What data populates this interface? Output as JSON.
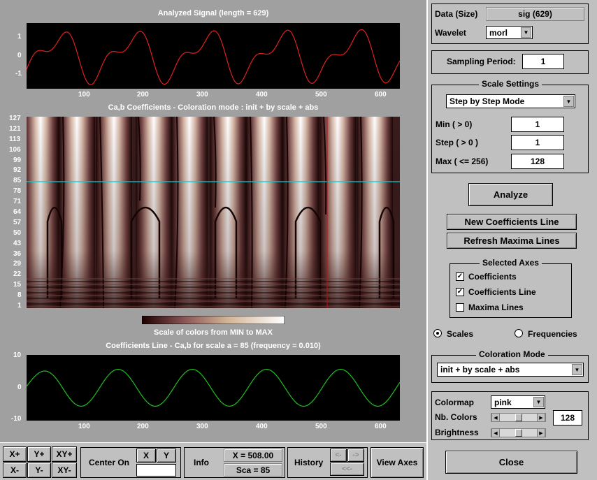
{
  "plots": {
    "signal": {
      "title": "Analyzed Signal  (length = 629)",
      "y_ticks": [
        "1",
        "0",
        "-1"
      ],
      "x_ticks": [
        "100",
        "200",
        "300",
        "400",
        "500",
        "600"
      ]
    },
    "coefs": {
      "title": "Ca,b Coefficients  - Coloration mode : init + by scale + abs",
      "y_ticks": [
        "127",
        "121",
        "113",
        "106",
        "99",
        "92",
        "85",
        "78",
        "71",
        "64",
        "57",
        "50",
        "43",
        "36",
        "29",
        "22",
        "15",
        "8",
        "1"
      ]
    },
    "colorbar_label": "Scale of colors from MIN to MAX",
    "line": {
      "title": "Coefficients Line - Ca,b  for scale a = 85  (frequency =   0.010)",
      "y_ticks": [
        "10",
        "0",
        "-10"
      ],
      "x_ticks": [
        "100",
        "200",
        "300",
        "400",
        "500",
        "600"
      ]
    }
  },
  "right": {
    "data_label": "Data  (Size)",
    "data_value": "sig  (629)",
    "wavelet_label": "Wavelet",
    "wavelet_value": "morl",
    "sampling_label": "Sampling Period:",
    "sampling_value": "1",
    "scale_settings_title": "Scale Settings",
    "scale_mode": "Step by Step Mode",
    "min_label": "Min  ( > 0)",
    "min_value": "1",
    "step_label": "Step ( > 0 )",
    "step_value": "1",
    "max_label": "Max  ( <= 256)",
    "max_value": "128",
    "analyze": "Analyze",
    "new_coef": "New Coefficients Line",
    "refresh": "Refresh Maxima Lines",
    "selected_axes_title": "Selected Axes",
    "axes": [
      {
        "label": "Coefficients",
        "checked": true
      },
      {
        "label": "Coefficients Line",
        "checked": true
      },
      {
        "label": "Maxima Lines",
        "checked": false
      }
    ],
    "scales": "Scales",
    "frequencies": "Frequencies",
    "coloration_title": "Coloration Mode",
    "coloration_value": "init + by scale + abs",
    "colormap_label": "Colormap",
    "colormap_value": "pink",
    "nbcolors_label": "Nb. Colors",
    "nbcolors_value": "128",
    "brightness_label": "Brightness",
    "close": "Close"
  },
  "bottom": {
    "xplus": "X+",
    "yplus": "Y+",
    "xyplus": "XY+",
    "xminus": "X-",
    "yminus": "Y-",
    "xyminus": "XY-",
    "center_on": "Center On",
    "x": "X",
    "y": "Y",
    "info": "Info",
    "x_readout": "X =  508.00",
    "sca_readout": "Sca = 85",
    "history": "History",
    "view_axes": "View Axes",
    "left_arrow": "<-",
    "right_arrow": "->",
    "back_arrow": "<<-"
  },
  "colors": {
    "accent_signal": "#e02020",
    "accent_line": "#20c020",
    "scale_line": "#00d0d0"
  }
}
